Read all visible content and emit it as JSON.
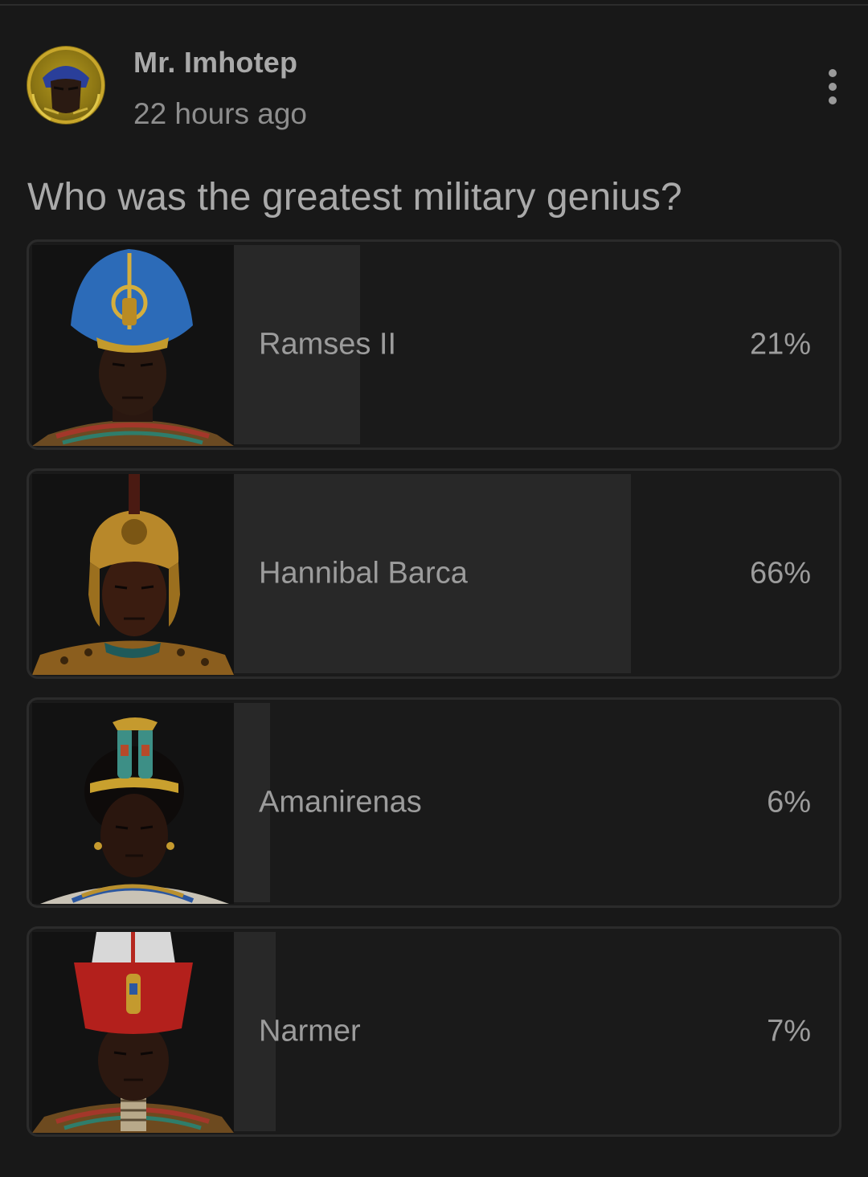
{
  "post": {
    "author": "Mr. Imhotep",
    "timestamp": "22 hours ago",
    "more_icon": "vertical-ellipsis-icon",
    "avatar_icon": "pharaoh-portrait-avatar"
  },
  "poll": {
    "question": "Who was the greatest military genius?",
    "bar_color": "#282828",
    "options": [
      {
        "label": "Ramses II",
        "percent_text": "21%",
        "percent": 21,
        "image": "ramses-ii-portrait-blue-crown"
      },
      {
        "label": "Hannibal Barca",
        "percent_text": "66%",
        "percent": 66,
        "image": "hannibal-barca-portrait-gold-helmet"
      },
      {
        "label": "Amanirenas",
        "percent_text": "6%",
        "percent": 6,
        "image": "amanirenas-portrait-cobra-crown"
      },
      {
        "label": "Narmer",
        "percent_text": "7%",
        "percent": 7,
        "image": "narmer-portrait-red-white-crown"
      }
    ]
  }
}
